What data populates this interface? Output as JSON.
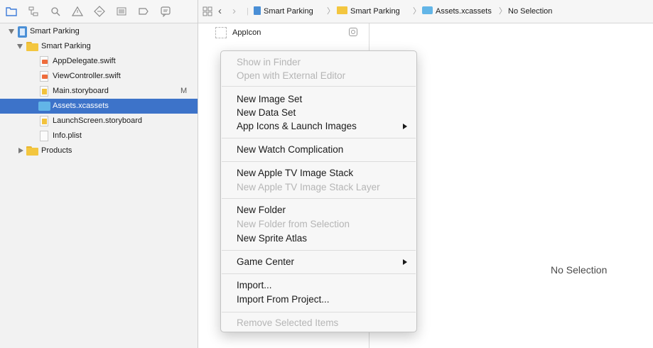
{
  "navigator": {
    "toolbar_icons": [
      "folder-icon",
      "hierarchy-icon",
      "search-icon",
      "warning-icon",
      "test-diamond-icon",
      "list-icon",
      "breakpoint-icon",
      "message-icon"
    ],
    "tree": [
      {
        "label": "Smart Parking",
        "kind": "project",
        "level": 0,
        "disclosure": "open"
      },
      {
        "label": "Smart Parking",
        "kind": "folder",
        "level": 1,
        "disclosure": "open"
      },
      {
        "label": "AppDelegate.swift",
        "kind": "swift",
        "level": 2
      },
      {
        "label": "ViewController.swift",
        "kind": "swift",
        "level": 2
      },
      {
        "label": "Main.storyboard",
        "kind": "storyboard",
        "level": 2,
        "badge": "M"
      },
      {
        "label": "Assets.xcassets",
        "kind": "assets",
        "level": 2,
        "selected": true
      },
      {
        "label": "LaunchScreen.storyboard",
        "kind": "storyboard",
        "level": 2
      },
      {
        "label": "Info.plist",
        "kind": "plist",
        "level": 2
      },
      {
        "label": "Products",
        "kind": "folder",
        "level": 1,
        "disclosure": "closed"
      }
    ]
  },
  "jump_bar": {
    "crumbs": [
      "Smart Parking",
      "Smart Parking",
      "Assets.xcassets",
      "No Selection"
    ]
  },
  "asset_list": {
    "items": [
      "AppIcon"
    ]
  },
  "editor": {
    "placeholder": "No Selection"
  },
  "context_menu": {
    "items": [
      {
        "label": "Show in Finder",
        "enabled": false
      },
      {
        "label": "Open with External Editor",
        "enabled": false
      },
      {
        "separator": true
      },
      {
        "label": "New Image Set",
        "enabled": true
      },
      {
        "label": "New Data Set",
        "enabled": true
      },
      {
        "label": "App Icons & Launch Images",
        "enabled": true,
        "submenu": true
      },
      {
        "separator": true
      },
      {
        "label": "New Watch Complication",
        "enabled": true
      },
      {
        "separator": true
      },
      {
        "label": "New Apple TV Image Stack",
        "enabled": true
      },
      {
        "label": "New Apple TV Image Stack Layer",
        "enabled": false
      },
      {
        "separator": true
      },
      {
        "label": "New Folder",
        "enabled": true
      },
      {
        "label": "New Folder from Selection",
        "enabled": false
      },
      {
        "label": "New Sprite Atlas",
        "enabled": true
      },
      {
        "separator": true
      },
      {
        "label": "Game Center",
        "enabled": true,
        "submenu": true
      },
      {
        "separator": true
      },
      {
        "label": "Import...",
        "enabled": true
      },
      {
        "label": "Import From Project...",
        "enabled": true
      },
      {
        "separator": true
      },
      {
        "label": "Remove Selected Items",
        "enabled": false
      }
    ]
  },
  "colors": {
    "selection": "#3d73c9",
    "folder": "#f3c63f",
    "disabled_text": "#b5b5b5"
  }
}
